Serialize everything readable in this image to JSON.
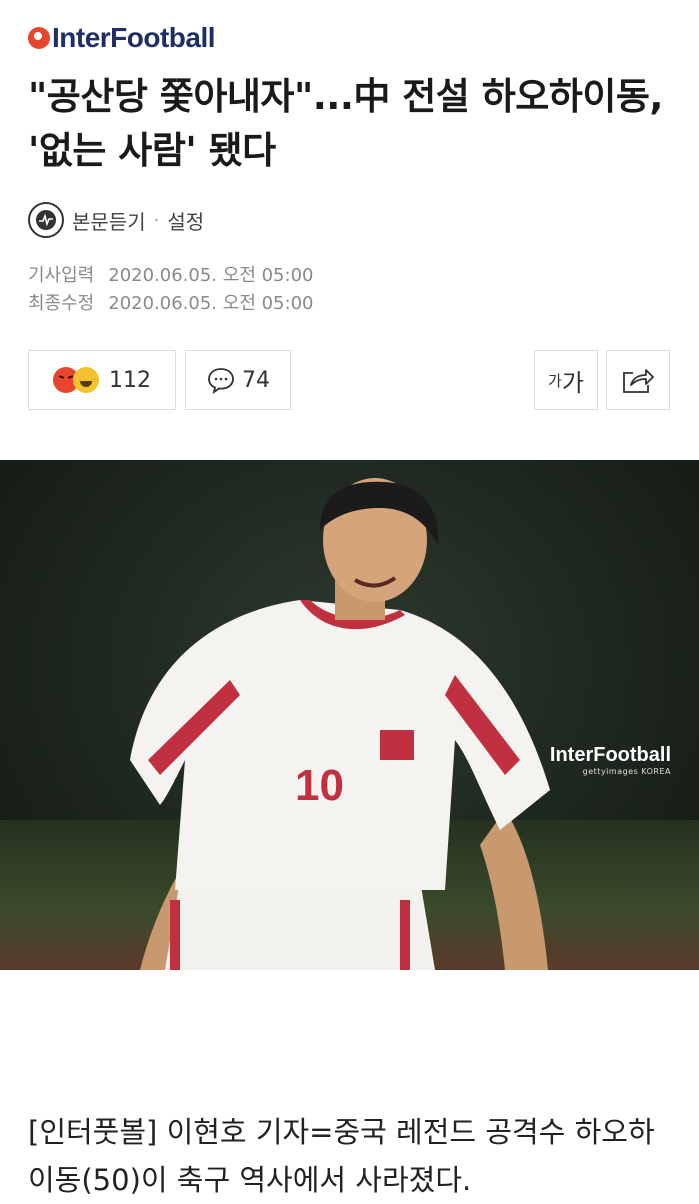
{
  "brand": {
    "logo_text": "InterFootball"
  },
  "article": {
    "headline": "\"공산당 쫓아내자\"...中 전설 하오하이동, '없는 사람' 됐다",
    "listen_label": "본문듣기",
    "settings_label": "설정",
    "meta": {
      "input_label": "기사입력",
      "input_time": "2020.06.05. 오전 05:00",
      "modified_label": "최종수정",
      "modified_time": "2020.06.05. 오전 05:00"
    },
    "photo": {
      "watermark_brand": "InterFootball",
      "watermark_source": "gettyimages KOREA",
      "jersey_number": "10"
    },
    "body": "[인터풋볼] 이현호 기자=중국 레전드 공격수 하오하이동(50)이 축구 역사에서 사라졌다."
  },
  "toolbar": {
    "reaction_count": "112",
    "comment_count": "74",
    "font_size_label_small": "가",
    "font_size_label_large": "가"
  },
  "colors": {
    "brand_red": "#e8452f",
    "brand_navy": "#1f2f66"
  }
}
